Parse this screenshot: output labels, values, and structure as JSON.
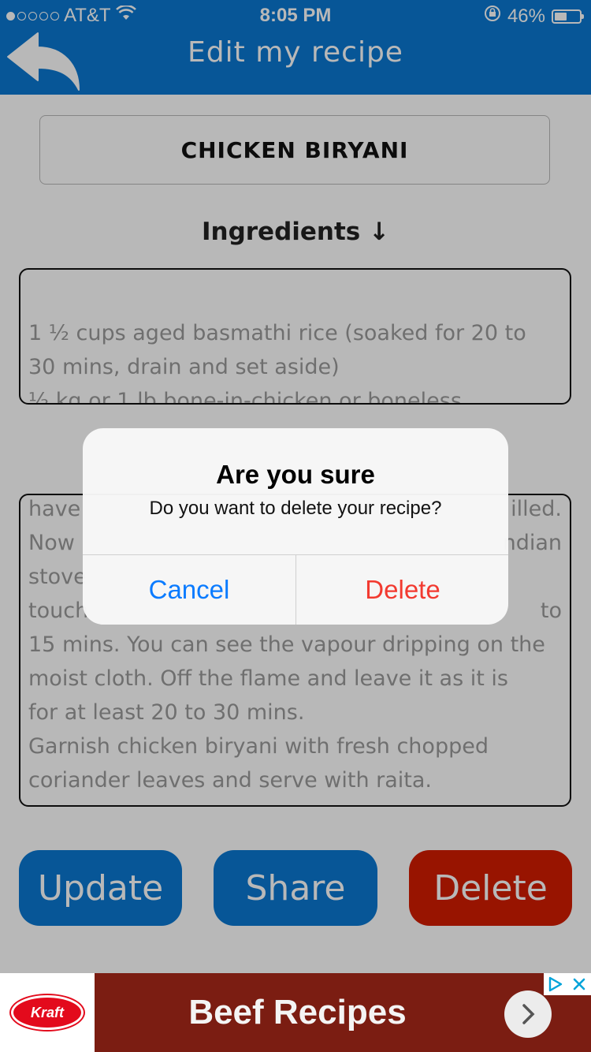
{
  "status_bar": {
    "carrier": "AT&T",
    "time": "8:05 PM",
    "battery": "46%",
    "battery_level": 0.46
  },
  "nav": {
    "title": "Edit my recipe",
    "back_icon": "back-arrow-icon"
  },
  "recipe": {
    "name": "CHICKEN BIRYANI",
    "ingredients_label": "Ingredients ↓",
    "ingredients_lines": [
      "1 ½ cups aged basmathi rice (soaked for 20 to",
      "30 mins, drain and set aside)",
      "½ kg or 1 lb bone-in-chicken or boneless"
    ],
    "method_lines": [
      "have",
      "Now",
      "stove",
      "touch",
      "15 mins. You can see the vapour dripping on the",
      "moist cloth. Off the flame and leave it as it is",
      "for at least 20 to 30 mins.",
      "Garnish chicken biryani with fresh chopped",
      "coriander leaves and serve with raita."
    ],
    "method_line_tails": {
      "0": "illed.",
      "1": "ndian",
      "3": "to"
    }
  },
  "actions": {
    "update": "Update",
    "share": "Share",
    "delete": "Delete"
  },
  "ad": {
    "brand": "Kraft",
    "headline": "Beef Recipes"
  },
  "dialog": {
    "title": "Are you sure",
    "message": "Do you want to delete your recipe?",
    "cancel": "Cancel",
    "confirm": "Delete"
  },
  "colors": {
    "primary": "#0a78d2",
    "danger": "#d31c00",
    "ad_background": "#7b1d12",
    "dialog_cancel": "#0a7bff",
    "dialog_delete": "#f23a30"
  }
}
